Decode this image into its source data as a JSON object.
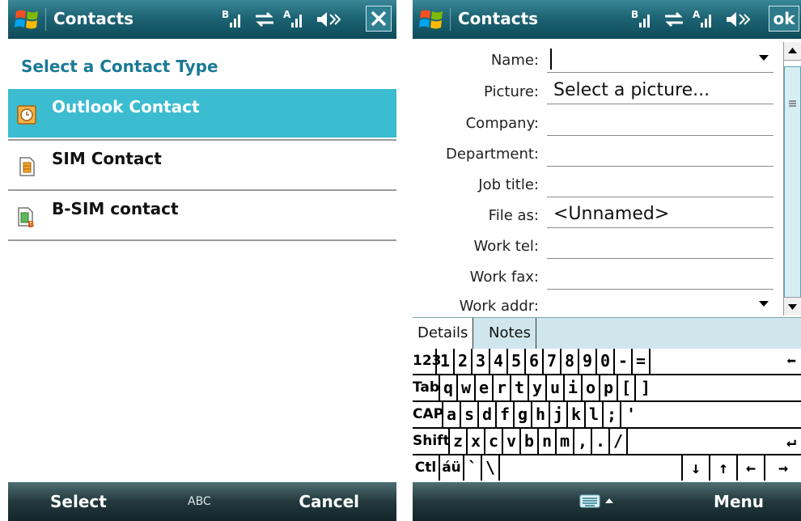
{
  "colors": {
    "titlebar": "#1d6474",
    "selection": "#3cbcd0",
    "subtitle": "#1a7a96",
    "softbar": "#23393d"
  },
  "left": {
    "title": "Contacts",
    "subtitle": "Select a Contact Type",
    "items": [
      {
        "label": "Outlook Contact",
        "icon": "outlook-contact-icon",
        "selected": true
      },
      {
        "label": "SIM Contact",
        "icon": "sim-contact-icon",
        "selected": false
      },
      {
        "label": "B-SIM contact",
        "icon": "b-sim-contact-icon",
        "selected": false
      }
    ],
    "softkeys": {
      "left": "Select",
      "middle": "ABC",
      "right": "Cancel"
    }
  },
  "right": {
    "title": "Contacts",
    "ok_label": "ok",
    "fields": [
      {
        "label": "Name:",
        "value": "",
        "dropdown": true
      },
      {
        "label": "Picture:",
        "value": "Select a picture...",
        "dropdown": false
      },
      {
        "label": "Company:",
        "value": "",
        "dropdown": false
      },
      {
        "label": "Department:",
        "value": "",
        "dropdown": false
      },
      {
        "label": "Job title:",
        "value": "",
        "dropdown": false
      },
      {
        "label": "File as:",
        "value": "<Unnamed>",
        "dropdown": false
      },
      {
        "label": "Work tel:",
        "value": "",
        "dropdown": false
      },
      {
        "label": "Work fax:",
        "value": "",
        "dropdown": false
      },
      {
        "label": "Work addr:",
        "value": "",
        "dropdown": true
      }
    ],
    "tabs": [
      "Details",
      "Notes"
    ],
    "keyboard": {
      "rows": [
        [
          "123",
          "1",
          "2",
          "3",
          "4",
          "5",
          "6",
          "7",
          "8",
          "9",
          "0",
          "-",
          "=",
          "⬅"
        ],
        [
          "Tab",
          "q",
          "w",
          "e",
          "r",
          "t",
          "y",
          "u",
          "i",
          "o",
          "p",
          "[",
          "]"
        ],
        [
          "CAP",
          "a",
          "s",
          "d",
          "f",
          "g",
          "h",
          "j",
          "k",
          "l",
          ";",
          "'"
        ],
        [
          "Shift",
          "z",
          "x",
          "c",
          "v",
          "b",
          "n",
          "m",
          ",",
          ".",
          "/",
          "↵"
        ],
        [
          "Ctl",
          "áü",
          "`",
          "\\",
          "",
          "↓",
          "↑",
          "←",
          "→"
        ]
      ]
    },
    "softkeys": {
      "right": "Menu",
      "middle_icon": "keyboard-icon"
    }
  }
}
